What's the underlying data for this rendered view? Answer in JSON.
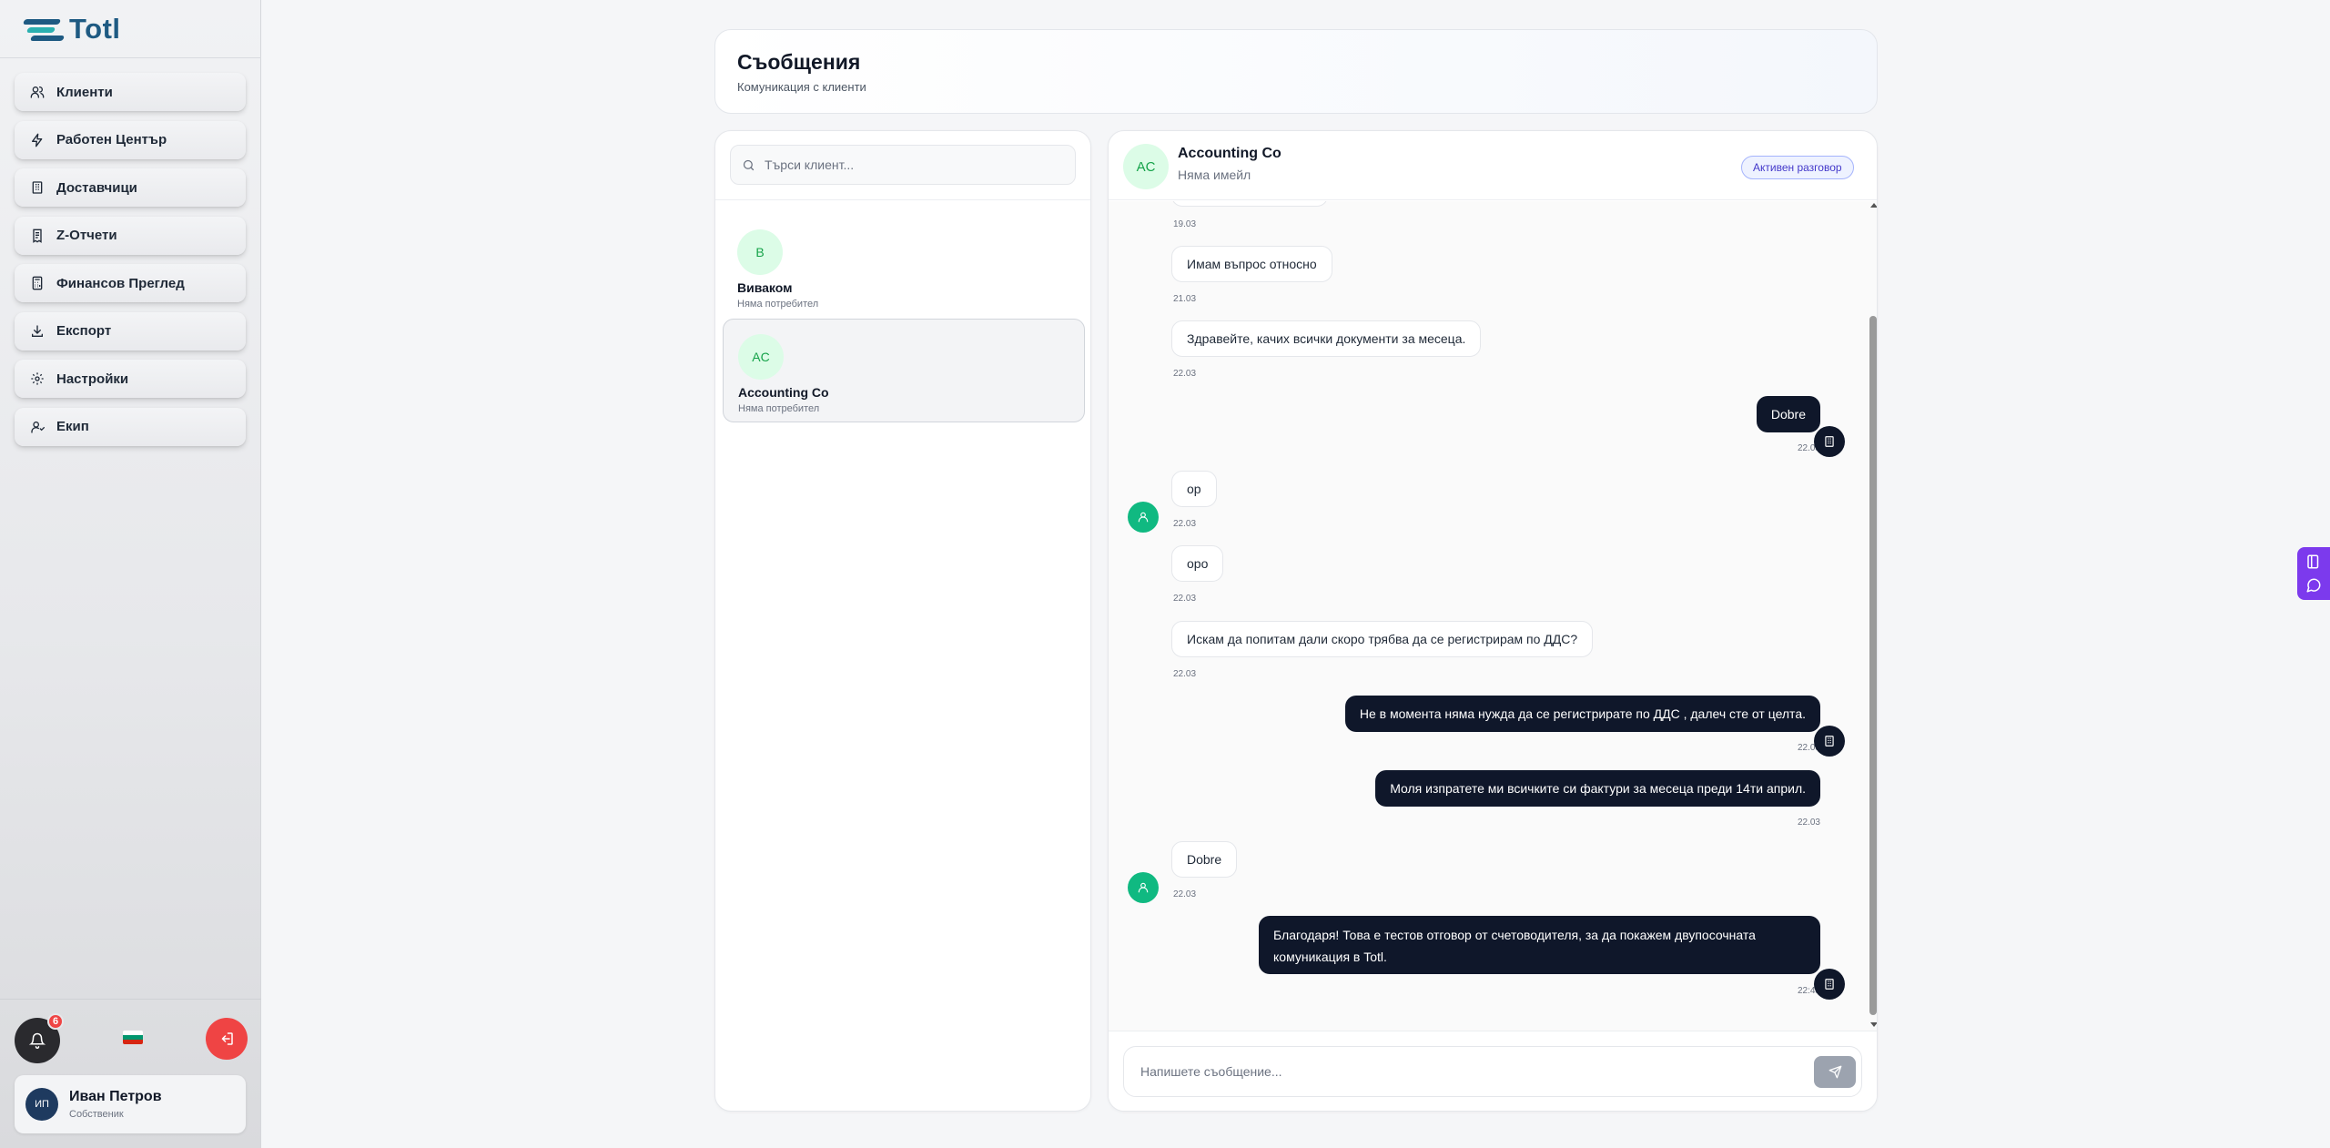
{
  "app": {
    "name": "Totl"
  },
  "sidebar": {
    "items": [
      {
        "label": "Клиенти",
        "icon": "users-icon"
      },
      {
        "label": "Работен Център",
        "icon": "zap-icon"
      },
      {
        "label": "Доставчици",
        "icon": "building-icon"
      },
      {
        "label": "Z-Отчети",
        "icon": "receipt-icon"
      },
      {
        "label": "Финансов Преглед",
        "icon": "calculator-icon"
      },
      {
        "label": "Експорт",
        "icon": "download-icon"
      },
      {
        "label": "Настройки",
        "icon": "gear-icon"
      },
      {
        "label": "Екип",
        "icon": "team-icon"
      }
    ],
    "notifications_count": "6",
    "language_flag": "bg",
    "user": {
      "initials": "ИП",
      "name": "Иван Петров",
      "role": "Собственик"
    }
  },
  "header": {
    "title": "Съобщения",
    "subtitle": "Комуникация с клиенти"
  },
  "clients": {
    "search_placeholder": "Търси клиент...",
    "items": [
      {
        "initials": "В",
        "name": "Виваком",
        "sub": "Няма потребител",
        "active": false
      },
      {
        "initials": "AC",
        "name": "Accounting Co",
        "sub": "Няма потребител",
        "active": true
      }
    ]
  },
  "chat": {
    "initials": "AC",
    "name": "Accounting Co",
    "email": "Няма имейл",
    "status_badge": "Активен разговор",
    "messages": [
      {
        "from": "client",
        "text": "",
        "time": "19.03"
      },
      {
        "from": "client",
        "text": "Имам въпрос относно",
        "time": "21.03"
      },
      {
        "from": "client",
        "text": "Здравейте, качих всички документи за месеца.",
        "time": "22.03"
      },
      {
        "from": "accountant",
        "text": "Dobre",
        "time": "22.03"
      },
      {
        "from": "client",
        "text": "op",
        "time": "22.03"
      },
      {
        "from": "client",
        "text": "opo",
        "time": "22.03"
      },
      {
        "from": "client",
        "text": "Искам да попитам дали скоро трябва да се регистрирам по ДДС?",
        "time": "22.03"
      },
      {
        "from": "accountant",
        "text": "Не в момента няма нужда да се регистрирате по ДДС , далеч сте от целта.",
        "time": "22.03"
      },
      {
        "from": "accountant",
        "text": "Моля изпратете ми всичките си фактури за месеца преди 14ти април.",
        "time": "22.03"
      },
      {
        "from": "client",
        "text": "Dobre",
        "time": "22.03"
      },
      {
        "from": "accountant",
        "text": "Благодаря! Това е тестов отговор от счетоводителя, за да покажем двупосочната комуникация в Totl.",
        "time": "22:48"
      }
    ],
    "input_placeholder": "Напишете съобщение..."
  },
  "colors": {
    "accent": "#0f172a",
    "client_avatar": "#10b981",
    "logout": "#ef4444",
    "widget": "#7c3aed"
  }
}
